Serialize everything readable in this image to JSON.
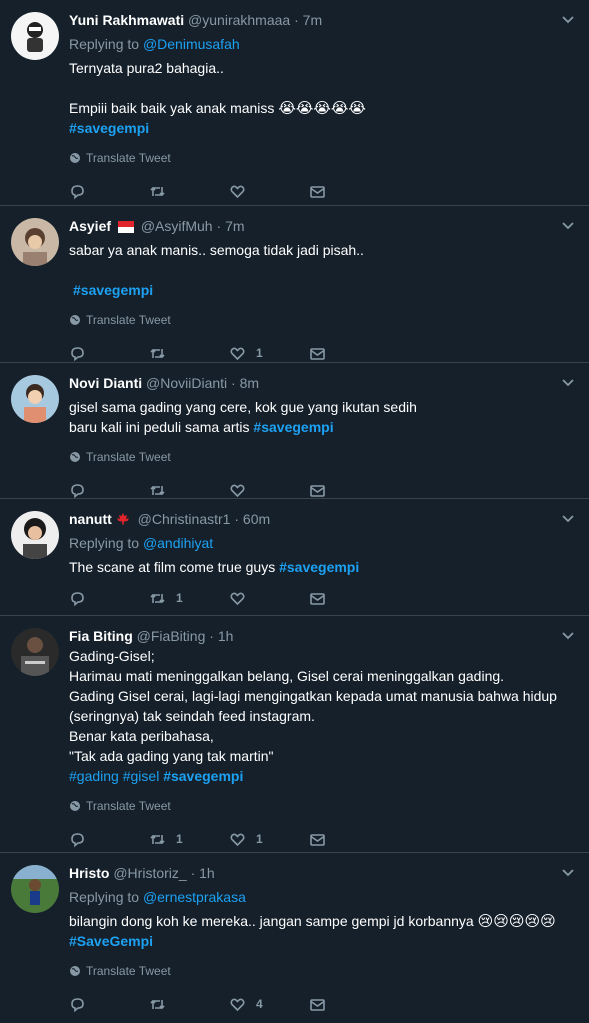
{
  "translate_label": "Translate Tweet",
  "colors": {
    "background": "#15202b",
    "link": "#1da1f2",
    "muted": "#8899a6",
    "divider": "#38444d"
  },
  "tweets": [
    {
      "name": "Yuni Rakhmawati",
      "handle": "@yunirakhmaaa",
      "dot": "·",
      "time": "7m",
      "replying_label": "Replying to",
      "replying_to": "@Denimusafah",
      "lines": [
        "Ternyata pura2 bahagia..",
        "",
        "Empiii baik baik yak anak maniss"
      ],
      "emojis": "😭😭😭😭😭",
      "hashtag": "#savegempi",
      "counts": {
        "reply": "",
        "retweet": "",
        "like": ""
      }
    },
    {
      "name": "Asyief",
      "handle": "@AsyifMuh",
      "dot": "·",
      "time": "7m",
      "lines": [
        "sabar ya anak manis.. semoga tidak jadi pisah.."
      ],
      "hashtag": "#savegempi",
      "counts": {
        "reply": "",
        "retweet": "",
        "like": "1"
      }
    },
    {
      "name": "Novi Dianti",
      "handle": "@NoviiDianti",
      "dot": "·",
      "time": "8m",
      "lines": [
        "gisel sama gading yang cere, kok gue yang ikutan sedih",
        "baru kali ini peduli sama artis"
      ],
      "hashtag": "#savegempi",
      "counts": {
        "reply": "",
        "retweet": "",
        "like": ""
      }
    },
    {
      "name": "nanutt",
      "handle": "@Christinastr1",
      "dot": "·",
      "time": "60m",
      "replying_label": "Replying to",
      "replying_to": "@andihiyat",
      "lines": [
        "The scane at film come true guys"
      ],
      "hashtag": "#savegempi",
      "counts": {
        "reply": "",
        "retweet": "1",
        "like": ""
      }
    },
    {
      "name": "Fia Biting",
      "handle": "@FiaBiting",
      "dot": "·",
      "time": "1h",
      "lines": [
        "Gading-Gisel;",
        "Harimau mati meninggalkan belang, Gisel cerai meninggalkan gading.",
        "Gading Gisel cerai, lagi-lagi mengingatkan kepada umat manusia bahwa hidup",
        "(seringnya) tak seindah feed instagram.",
        "Benar kata peribahasa,",
        "\"Tak ada gading yang tak martin\""
      ],
      "hashtags": [
        "#gading",
        "#gisel",
        "#savegempi"
      ],
      "counts": {
        "reply": "",
        "retweet": "1",
        "like": "1"
      }
    },
    {
      "name": "Hristo",
      "handle": "@Hristoriz_",
      "dot": "·",
      "time": "1h",
      "replying_label": "Replying to",
      "replying_to": "@ernestprakasa",
      "lines": [
        "bilangin dong koh ke mereka.. jangan sampe gempi jd korbannya"
      ],
      "emojis": "😢😢😢😢😢",
      "hashtag": "#SaveGempi",
      "counts": {
        "reply": "",
        "retweet": "",
        "like": "4"
      }
    }
  ]
}
